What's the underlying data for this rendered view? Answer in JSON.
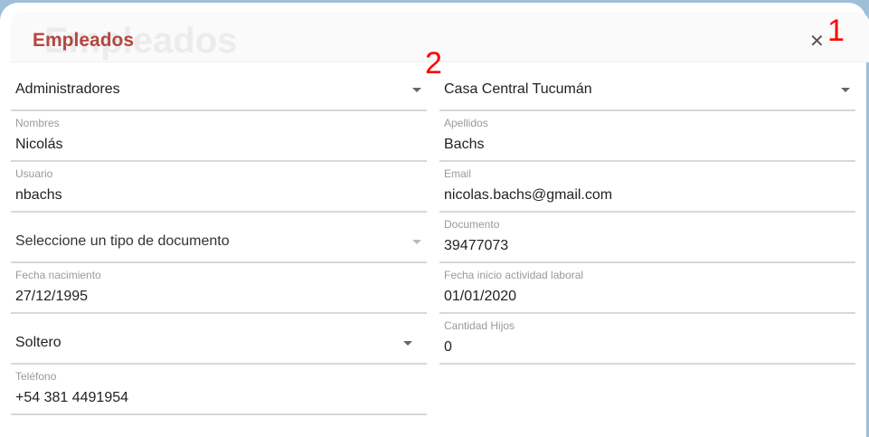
{
  "modal": {
    "title": "Empleados",
    "close_icon": "close-icon"
  },
  "annotations": [
    "1",
    "2"
  ],
  "fields": {
    "rol": {
      "value": "Administradores"
    },
    "sucursal": {
      "value": "Casa Central Tucumán"
    },
    "nombres": {
      "label": "Nombres",
      "value": "Nicolás"
    },
    "apellidos": {
      "label": "Apellidos",
      "value": "Bachs"
    },
    "usuario": {
      "label": "Usuario",
      "value": "nbachs"
    },
    "email": {
      "label": "Email",
      "value": "nicolas.bachs@gmail.com"
    },
    "tipo_documento": {
      "placeholder": "Seleccione un tipo de documento"
    },
    "documento": {
      "label": "Documento",
      "value": "39477073"
    },
    "fecha_nacimiento": {
      "label": "Fecha nacimiento",
      "value": "27/12/1995"
    },
    "fecha_inicio": {
      "label": "Fecha inicio actividad laboral",
      "value": "01/01/2020"
    },
    "estado_civil": {
      "value": "Soltero"
    },
    "cantidad_hijos": {
      "label": "Cantidad Hijos",
      "value": "0"
    },
    "telefono": {
      "label": "Teléfono",
      "value": "+54 381 4491954"
    }
  }
}
